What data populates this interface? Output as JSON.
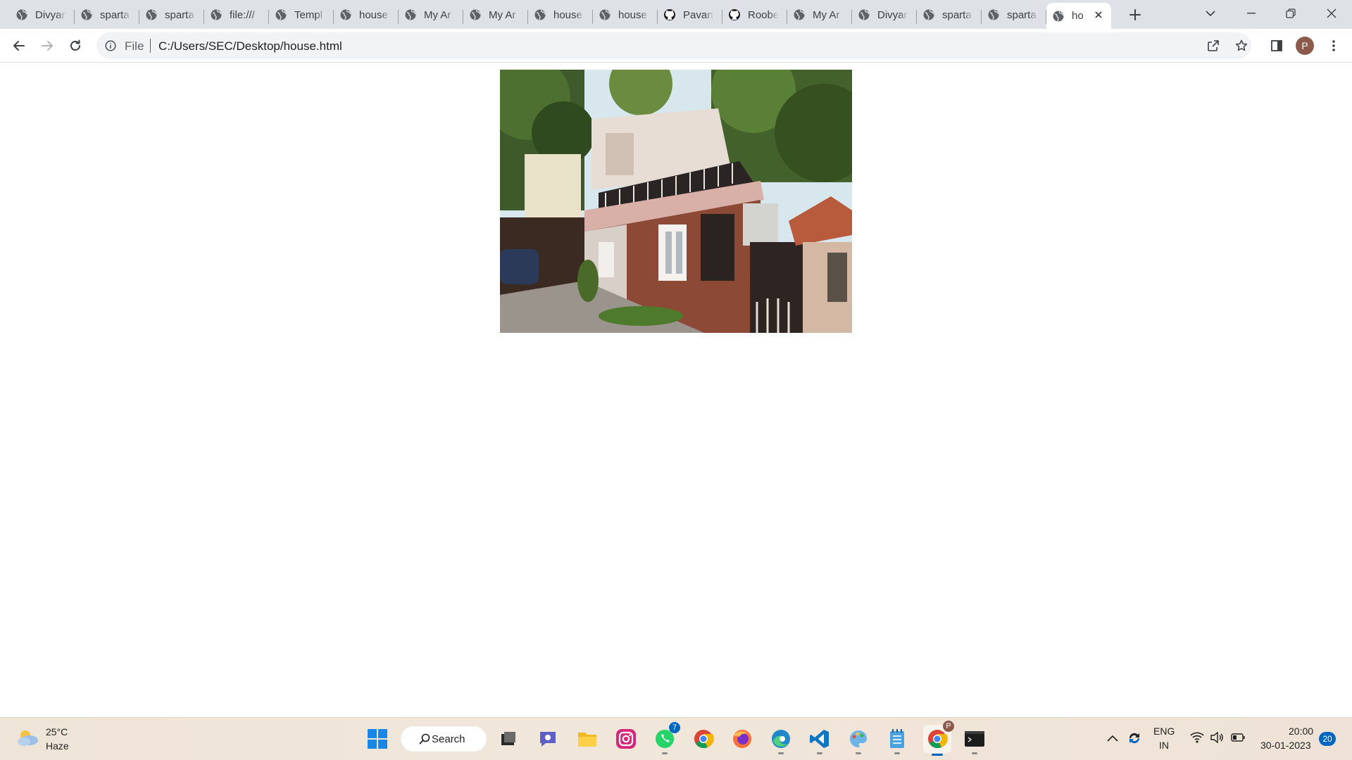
{
  "browser": {
    "tabs": [
      {
        "title": "Divyan",
        "icon": "globe-icon"
      },
      {
        "title": "sparta",
        "icon": "globe-icon"
      },
      {
        "title": "sparta",
        "icon": "globe-icon"
      },
      {
        "title": "file:///",
        "icon": "globe-icon"
      },
      {
        "title": "Templ",
        "icon": "globe-icon"
      },
      {
        "title": "house",
        "icon": "globe-icon"
      },
      {
        "title": "My Ar",
        "icon": "globe-icon"
      },
      {
        "title": "My Ar",
        "icon": "globe-icon"
      },
      {
        "title": "house",
        "icon": "globe-icon"
      },
      {
        "title": "house",
        "icon": "globe-icon"
      },
      {
        "title": "Pavan",
        "icon": "github-icon"
      },
      {
        "title": "Roobe",
        "icon": "github-icon"
      },
      {
        "title": "My Ar",
        "icon": "globe-icon"
      },
      {
        "title": "Divyan",
        "icon": "globe-icon"
      },
      {
        "title": "sparta",
        "icon": "globe-icon"
      },
      {
        "title": "sparta",
        "icon": "globe-icon"
      },
      {
        "title": "ho",
        "icon": "globe-icon",
        "active": true
      }
    ],
    "address_bar": {
      "scheme_label": "File",
      "url": "C:/Users/SEC/Desktop/house.html"
    },
    "profile_initial": "P"
  },
  "page": {
    "image": "house photograph"
  },
  "taskbar": {
    "weather": {
      "temperature": "25°C",
      "condition": "Haze"
    },
    "search_label": "Search",
    "whatsapp_badge": "7",
    "chrome_profile_badge": "P",
    "language": {
      "line1": "ENG",
      "line2": "IN"
    },
    "clock": {
      "time": "20:00",
      "date": "30-01-2023"
    },
    "notification_count": "20"
  },
  "colors": {
    "tabstrip": "#dee1e6",
    "omnibox": "#f1f3f4",
    "accent": "#0067c0"
  }
}
